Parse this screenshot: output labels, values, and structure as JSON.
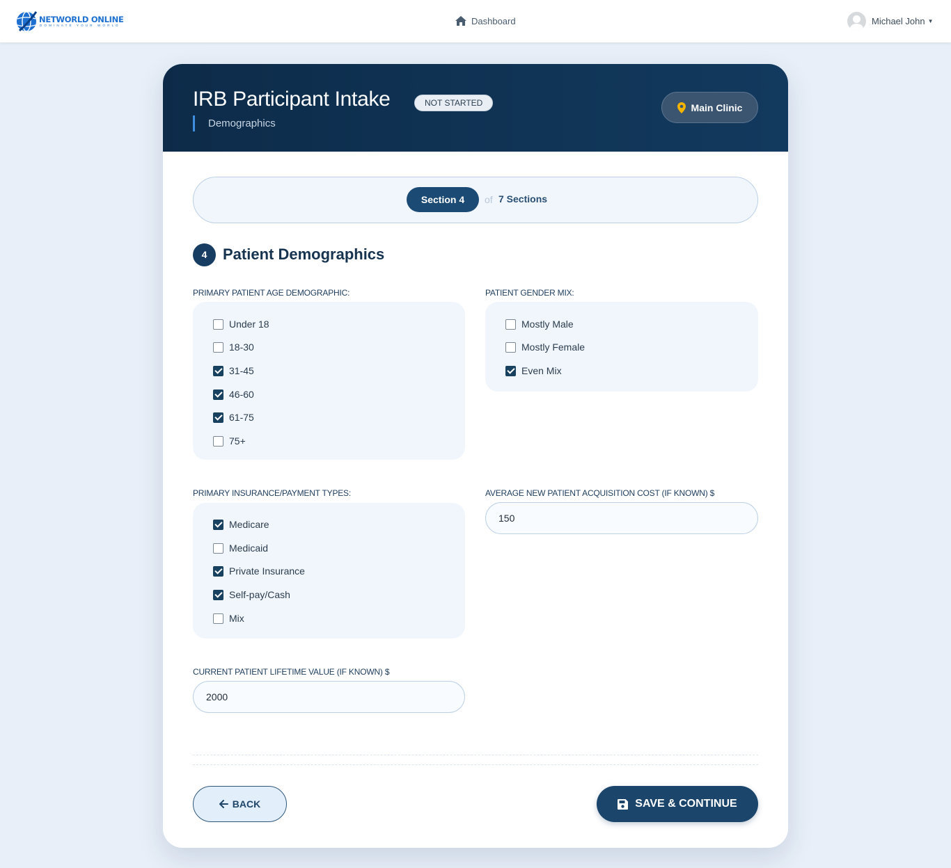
{
  "nav": {
    "logo_title": "NETWORLD ONLINE",
    "logo_tagline": "DOMINATE YOUR WORLD",
    "dashboard_label": "Dashboard",
    "user_name": "Michael John"
  },
  "header": {
    "title": "IRB Participant Intake",
    "status": "NOT STARTED",
    "subtitle": "Demographics",
    "location": "Main Clinic"
  },
  "progress": {
    "current": "Section 4",
    "of": "of",
    "total": "7 Sections"
  },
  "section": {
    "number": "4",
    "title": "Patient Demographics"
  },
  "fields": {
    "age": {
      "label": "PRIMARY PATIENT AGE DEMOGRAPHIC:",
      "options": [
        {
          "label": "Under 18",
          "checked": false
        },
        {
          "label": "18-30",
          "checked": false
        },
        {
          "label": "31-45",
          "checked": true
        },
        {
          "label": "46-60",
          "checked": true
        },
        {
          "label": "61-75",
          "checked": true
        },
        {
          "label": "75+",
          "checked": false
        }
      ]
    },
    "gender": {
      "label": "PATIENT GENDER MIX:",
      "options": [
        {
          "label": "Mostly Male",
          "checked": false
        },
        {
          "label": "Mostly Female",
          "checked": false
        },
        {
          "label": "Even Mix",
          "checked": true
        }
      ]
    },
    "insurance": {
      "label": "PRIMARY INSURANCE/PAYMENT TYPES:",
      "options": [
        {
          "label": "Medicare",
          "checked": true
        },
        {
          "label": "Medicaid",
          "checked": false
        },
        {
          "label": "Private Insurance",
          "checked": true
        },
        {
          "label": "Self-pay/Cash",
          "checked": true
        },
        {
          "label": "Mix",
          "checked": false
        }
      ]
    },
    "acquisition_cost": {
      "label": "AVERAGE NEW PATIENT ACQUISITION COST (IF KNOWN) $",
      "value": "150"
    },
    "lifetime_value": {
      "label": "CURRENT PATIENT LIFETIME VALUE (IF KNOWN) $",
      "value": "2000"
    }
  },
  "actions": {
    "back": "BACK",
    "save": "SAVE & CONTINUE"
  },
  "colors": {
    "header_bg": "#0f3050",
    "accent": "#1b456b",
    "pin": "#f5b400",
    "page_bg": "#e8eff8"
  },
  "icons": {
    "dashboard": "home-icon",
    "location": "map-pin-icon",
    "back": "arrow-left-icon",
    "save": "floppy-disk-icon"
  }
}
